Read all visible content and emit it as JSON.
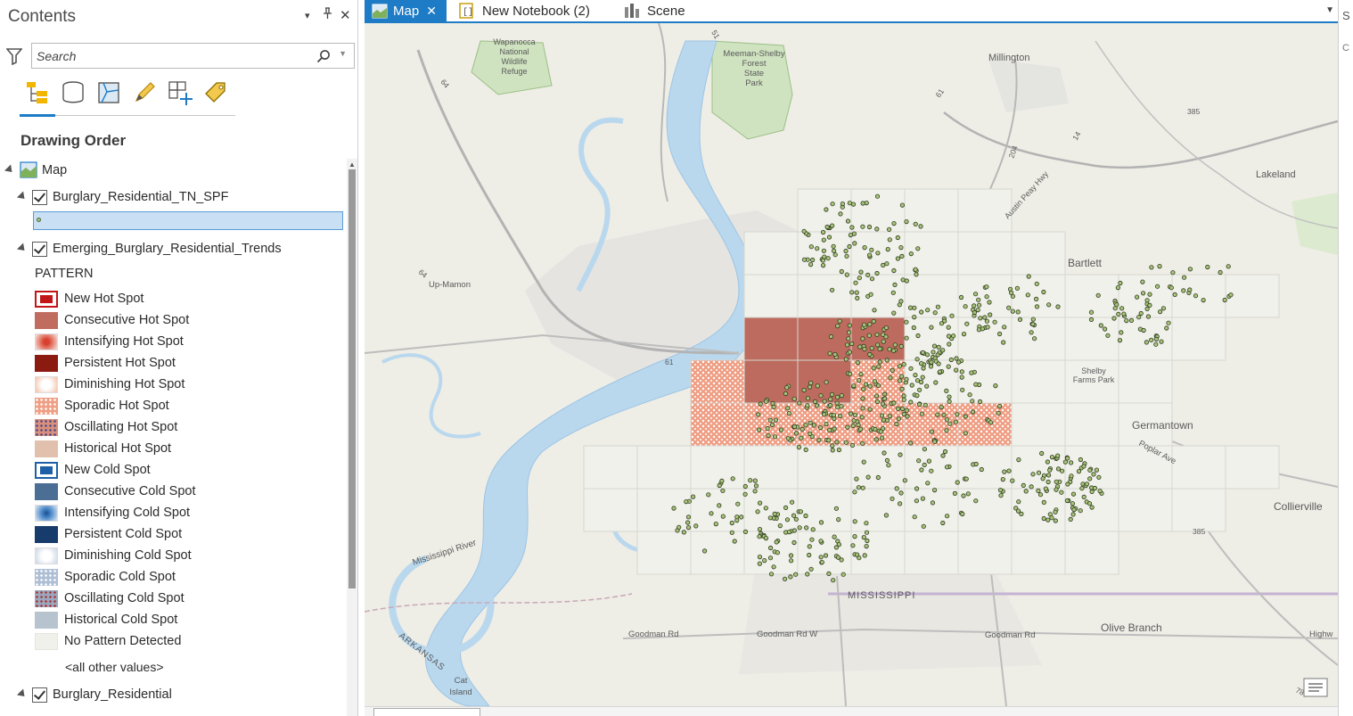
{
  "contents": {
    "title": "Contents",
    "controls": {
      "menu": "▾",
      "pin": "⊥",
      "close": "✕"
    },
    "search": {
      "placeholder": "Search"
    },
    "toolbar": {
      "items": [
        {
          "name": "list-by-drawing-order-icon"
        },
        {
          "name": "list-by-data-source-icon"
        },
        {
          "name": "list-by-selection-icon"
        },
        {
          "name": "list-by-editing-icon"
        },
        {
          "name": "list-by-snapping-icon"
        },
        {
          "name": "list-by-labeling-icon"
        }
      ]
    },
    "section_title": "Drawing Order",
    "map_node": "Map",
    "layers": {
      "layer1": "Burglary_Residential_TN_SPF",
      "layer2": "Emerging_Burglary_Residential_Trends",
      "layer3": "Burglary_Residential"
    },
    "pattern_header": "PATTERN",
    "legend": [
      {
        "label": "New Hot Spot",
        "color": "#c21515"
      },
      {
        "label": "Consecutive Hot Spot",
        "color": "#c06d60"
      },
      {
        "label": "Intensifying Hot Spot",
        "color": "#d8412e"
      },
      {
        "label": "Persistent Hot Spot",
        "color": "#8b1a10"
      },
      {
        "label": "Diminishing Hot Spot",
        "color": "#f2c1a8"
      },
      {
        "label": "Sporadic Hot Spot",
        "color": "#ef9f85"
      },
      {
        "label": "Oscillating Hot Spot",
        "color": "#d98f7b"
      },
      {
        "label": "Historical Hot Spot",
        "color": "#e2c0ae"
      },
      {
        "label": "New Cold Spot",
        "color": "#1f5fa8"
      },
      {
        "label": "Consecutive Cold Spot",
        "color": "#4b6e94"
      },
      {
        "label": "Intensifying Cold Spot",
        "color": "#3e7fc3"
      },
      {
        "label": "Persistent Cold Spot",
        "color": "#173c6b"
      },
      {
        "label": "Diminishing Cold Spot",
        "color": "#cbd6e2"
      },
      {
        "label": "Sporadic Cold Spot",
        "color": "#aebfd5"
      },
      {
        "label": "Oscillating Cold Spot",
        "color": "#9aa7be"
      },
      {
        "label": "Historical Cold Spot",
        "color": "#b7c4cf"
      },
      {
        "label": "No Pattern Detected",
        "color": "#f1f1ec"
      }
    ],
    "other_values": "<all other values>"
  },
  "tabs": [
    {
      "label": "Map",
      "active": true,
      "close": "✕"
    },
    {
      "label": "New Notebook (2)",
      "active": false
    },
    {
      "label": "Scene",
      "active": false
    }
  ],
  "map": {
    "place_labels": {
      "wapanocca": [
        "Wapanocca",
        "National",
        "Wildlife",
        "Refuge"
      ],
      "meeman": [
        "Meeman-Shelby",
        "Forest",
        "State",
        "Park"
      ],
      "millington": "Millington",
      "lakeland": "Lakeland",
      "bartlett": "Bartlett",
      "germantown": "Germantown",
      "collierville": "Collierville",
      "olive_branch": "Olive Branch",
      "mississippi": "MISSISSIPPI",
      "arkansas": "ARKANSAS",
      "mississippi_river": "Mississippi River",
      "shelby_farms": [
        "Shelby",
        "Farms Park"
      ],
      "cat_island": [
        "Cat",
        "Island"
      ],
      "up_mamon": "Up-Mamon",
      "poplar_ave": "Poplar Ave",
      "austin_peay": "Austin Peay Hwy",
      "goodman1": "Goodman Rd",
      "goodman2": "Goodman Rd W",
      "goodman3": "Goodman Rd",
      "highway": "Highw",
      "route_385": "385",
      "route_385b": "385",
      "route_61": "61",
      "route_61b": "61",
      "route_64": "64",
      "route_64b": "64",
      "route_204": "204",
      "route_14": "14",
      "route_78": "78",
      "route_51": "51"
    }
  },
  "right_edge": {
    "letter": "S",
    "letter2": "C"
  }
}
